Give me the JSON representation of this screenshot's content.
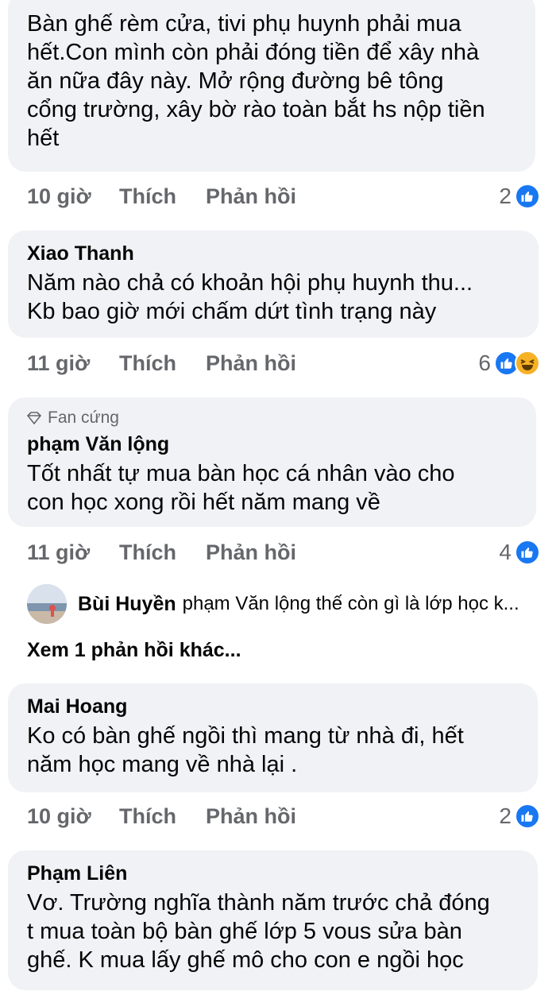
{
  "colors": {
    "accent": "#1877f2",
    "bubble": "#f0f2f5",
    "meta": "#65676b"
  },
  "comments": [
    {
      "author": "",
      "lines": [
        "Bàn ghế rèm cửa, tivi phụ huynh phải mua",
        "hết.Con mình còn phải đóng tiền để xây nhà",
        "ăn nữa đây này. Mở rộng đường bê tông",
        "cổng trường, xây bờ rào toàn bắt hs nộp tiền",
        "hết"
      ],
      "time": "10 giờ",
      "like": "Thích",
      "reply": "Phản hồi",
      "reaction_count": "2",
      "reactions": [
        "like-icon"
      ]
    },
    {
      "author": "Xiao Thanh",
      "lines": [
        "Năm nào chả có khoản hội phụ huynh thu...",
        "Kb bao giờ mới chấm dứt tình trạng này"
      ],
      "time": "11 giờ",
      "like": "Thích",
      "reply": "Phản hồi",
      "reaction_count": "6",
      "reactions": [
        "like-icon",
        "haha-icon"
      ]
    },
    {
      "badge": "Fan cứng",
      "author": "phạm Văn lộng",
      "lines": [
        "Tốt nhất tự mua bàn học cá nhân vào cho",
        "con học xong rồi hết năm mang về"
      ],
      "time": "11 giờ",
      "like": "Thích",
      "reply": "Phản hồi",
      "reaction_count": "4",
      "reactions": [
        "like-icon"
      ]
    },
    {
      "author": "Mai Hoang",
      "lines": [
        "Ko có bàn ghế ngồi thì mang từ nhà đi, hết",
        "năm học mang về nhà lại ."
      ],
      "time": "10 giờ",
      "like": "Thích",
      "reply": "Phản hồi",
      "reaction_count": "2",
      "reactions": [
        "like-icon"
      ]
    },
    {
      "author": "Phạm Liên",
      "lines": [
        "Vơ. Trường nghĩa thành năm trước chả đóng",
        "t mua toàn bộ bàn ghế lớp 5 vous sửa bàn",
        "ghế.  K mua lấy ghế mô cho con e ngồi học"
      ]
    }
  ],
  "reply_preview": {
    "author": "Bùi Huyền",
    "text": "phạm Văn lộng  thế còn gì là lớp học k..."
  },
  "view_more": "Xem 1 phản hồi khác..."
}
